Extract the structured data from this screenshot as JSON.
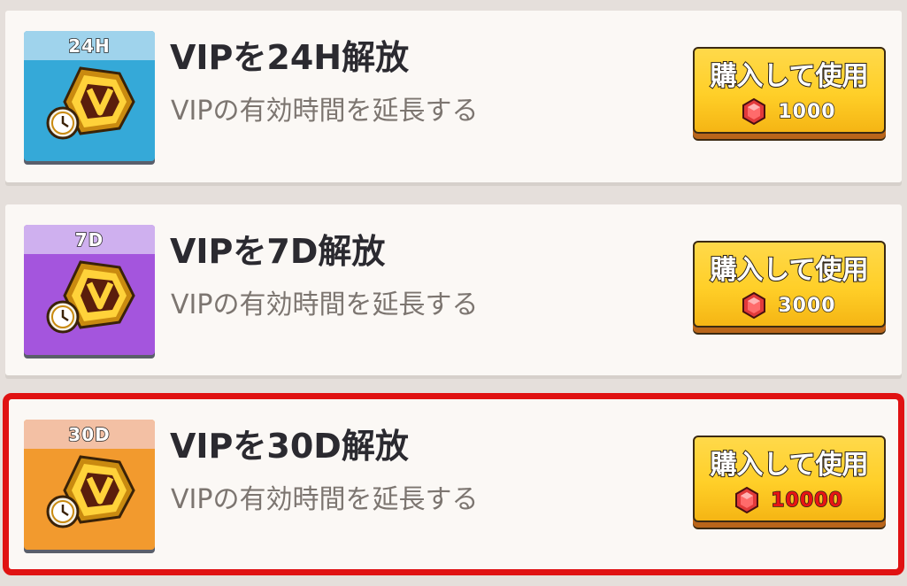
{
  "offers": [
    {
      "tag": "24H",
      "title": "VIPを24H解放",
      "description": "VIPの有効時間を延長する",
      "button_label": "購入して使用",
      "price": "1000",
      "price_affordable": true,
      "icon": "vip-badge-clock-icon",
      "tile_color": "#35a9d8",
      "tab_color": "#9fd3ec"
    },
    {
      "tag": "7D",
      "title": "VIPを7D解放",
      "description": "VIPの有効時間を延長する",
      "button_label": "購入して使用",
      "price": "3000",
      "price_affordable": true,
      "icon": "vip-badge-clock-icon",
      "tile_color": "#a455dd",
      "tab_color": "#cfb0ef"
    },
    {
      "tag": "30D",
      "title": "VIPを30D解放",
      "description": "VIPの有効時間を延長する",
      "button_label": "購入して使用",
      "price": "10000",
      "price_affordable": false,
      "icon": "vip-badge-clock-icon",
      "tile_color": "#f29a2e",
      "tab_color": "#f3c0a4"
    }
  ],
  "selected_offer": 2,
  "currency_icon": "ruby-gem-icon",
  "colors": {
    "button": "#ffcf28",
    "selected_outline": "#e01212",
    "price_insufficient": "#e81414"
  }
}
